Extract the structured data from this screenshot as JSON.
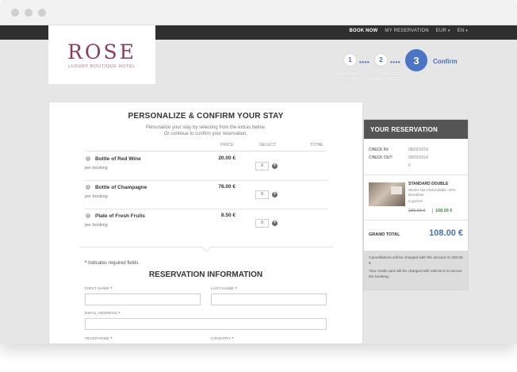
{
  "nav": {
    "book_now": "BOOK NOW",
    "my_reservation": "MY RESERVATION",
    "currency": "EUR",
    "language": "EN"
  },
  "logo": {
    "brand": "ROSE",
    "tagline": "LUXURY BOUTIQUE HOTEL"
  },
  "steps": {
    "step1_number": "1",
    "step1_caption_line1": "PLAN YOUR",
    "step1_caption_line2": "STAY",
    "step2_number": "2",
    "step2_caption_line1": "CHOOSE",
    "step2_caption_line2": "ROOMS & RATES",
    "step3_number": "3",
    "step3_label": "Confirm"
  },
  "personalize": {
    "title": "PERSONALIZE & CONFIRM YOUR STAY",
    "subtitle_line1": "Personalize your stay by selecting from the extras below.",
    "subtitle_line2": "Or continue to confirm your reservation.",
    "col_price": "PRICE",
    "col_select": "SELECT",
    "col_total": "TOTAL",
    "extras": [
      {
        "name": "Bottle of Red Wine",
        "per": "per booking",
        "price": "20.00 €",
        "qty": "0"
      },
      {
        "name": "Bottle of Champagne",
        "per": "per booking",
        "price": "78.00 €",
        "qty": "0"
      },
      {
        "name": "Plate of Fresh Fruits",
        "per": "per booking",
        "price": "8.50 €",
        "qty": "0"
      }
    ]
  },
  "form": {
    "required_note": "Indicates required fields.",
    "required_star": "*",
    "title": "RESERVATION INFORMATION",
    "first_name": "FIRST NAME",
    "last_name": "LAST NAME",
    "email": "EMAIL ADDRESS",
    "telephone": "TELEPHONE",
    "country": "COUNTRY"
  },
  "reservation": {
    "title": "YOUR RESERVATION",
    "check_in_label": "CHECK IN:",
    "check_in_value": "08/02/2019",
    "check_out_label": "CHECK OUT:",
    "check_out_value": "09/02/2019",
    "nights": "0",
    "room_name": "STANDARD DOUBLE",
    "room_desc": "Winter Non Refundable -40% Breakfast",
    "guests": "2 guests",
    "old_price": "180.00 €",
    "new_price": "108.00 €",
    "grand_total_label": "GRAND TOTAL",
    "grand_total_value": "108.00 €",
    "note_line1": "Cancellations will be charged with the amount of 108.00 €.",
    "note_line2": "Your credit card will be charged with 108.00 € to secure the booking."
  }
}
